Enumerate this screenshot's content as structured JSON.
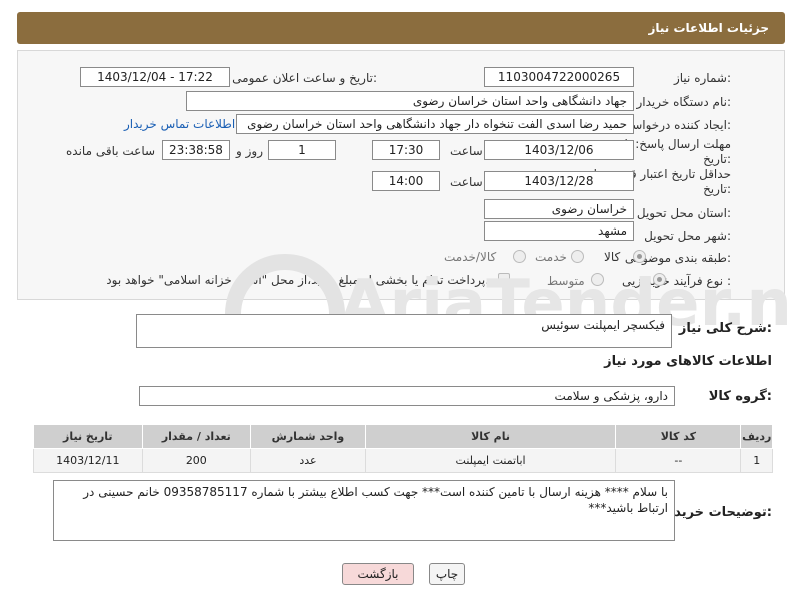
{
  "header": {
    "title": "جزئیات اطلاعات نیاز"
  },
  "form": {
    "need_number": {
      "label": "شماره نیاز:",
      "value": "1103004722000265"
    },
    "announce_datetime": {
      "label": "تاریخ و ساعت اعلان عمومی:",
      "value": "1403/12/04 - 17:22"
    },
    "buyer_org": {
      "label": "نام دستگاه خریدار:",
      "value": "جهاد دانشگاهی واحد استان خراسان رضوی"
    },
    "creator": {
      "label": "ایجاد کننده درخواست:",
      "value": "حمید رضا اسدی الفت تنخواه دار جهاد دانشگاهی واحد استان خراسان رضوی",
      "contact_link": "اطلاعات تماس خریدار"
    },
    "reply_deadline": {
      "label_line1": "مهلت ارسال پاسخ: تا",
      "label_line2": "تاریخ:",
      "date": "1403/12/06",
      "time_label": "ساعت",
      "time": "17:30",
      "days": "1",
      "days_label": "روز و",
      "remaining": "23:38:58",
      "remaining_label": "ساعت باقی مانده"
    },
    "price_validity": {
      "label_line1": "حداقل تاریخ اعتبار قیمت: تا",
      "label_line2": "تاریخ:",
      "date": "1403/12/28",
      "time_label": "ساعت",
      "time": "14:00"
    },
    "delivery_province": {
      "label": "استان محل تحویل:",
      "value": "خراسان رضوی"
    },
    "delivery_city": {
      "label": "شهر محل تحویل:",
      "value": "مشهد"
    },
    "category": {
      "label": "طبقه بندی موضوعی:",
      "options": [
        "کالا",
        "خدمت",
        "کالا/خدمت"
      ],
      "selected": "کالا"
    },
    "process_type": {
      "label": "نوع فرآیند خرید :",
      "options": [
        "جزیی",
        "متوسط"
      ],
      "selected": "جزیی",
      "payment_note": "پرداخت تمام یا بخشی از مبلغ خرید،از محل \"اسناد خزانه اسلامی\" خواهد بود."
    }
  },
  "description": {
    "label": "شرح کلی نیاز:",
    "value": "فیکسچر ایمپلنت سوئیس"
  },
  "goods_info": {
    "title": "اطلاعات کالاهای مورد نیاز"
  },
  "goods_group": {
    "label": "گروه کالا:",
    "value": "دارو، پزشکی و سلامت"
  },
  "table": {
    "headers": [
      "ردیف",
      "کد کالا",
      "نام کالا",
      "واحد شمارش",
      "تعداد / مقدار",
      "تاریخ نیاز"
    ],
    "rows": [
      [
        "1",
        "--",
        "اباتمنت ایمپلنت",
        "عدد",
        "200",
        "1403/12/11"
      ]
    ]
  },
  "buyer_notes": {
    "label": "توضیحات خریدار:",
    "value": "با سلام **** هزینه ارسال با تامین کننده است*** جهت کسب اطلاع بیشتر با شماره 09358785117 خانم حسینی در ارتباط باشید***"
  },
  "buttons": {
    "print": "چاپ",
    "back": "بازگشت"
  },
  "watermark": {
    "text": "AriaTender.neT"
  },
  "colors": {
    "header_bg": "#8b6d3e",
    "link": "#1a5fb4",
    "back_button_bg": "#f7d9d9"
  }
}
